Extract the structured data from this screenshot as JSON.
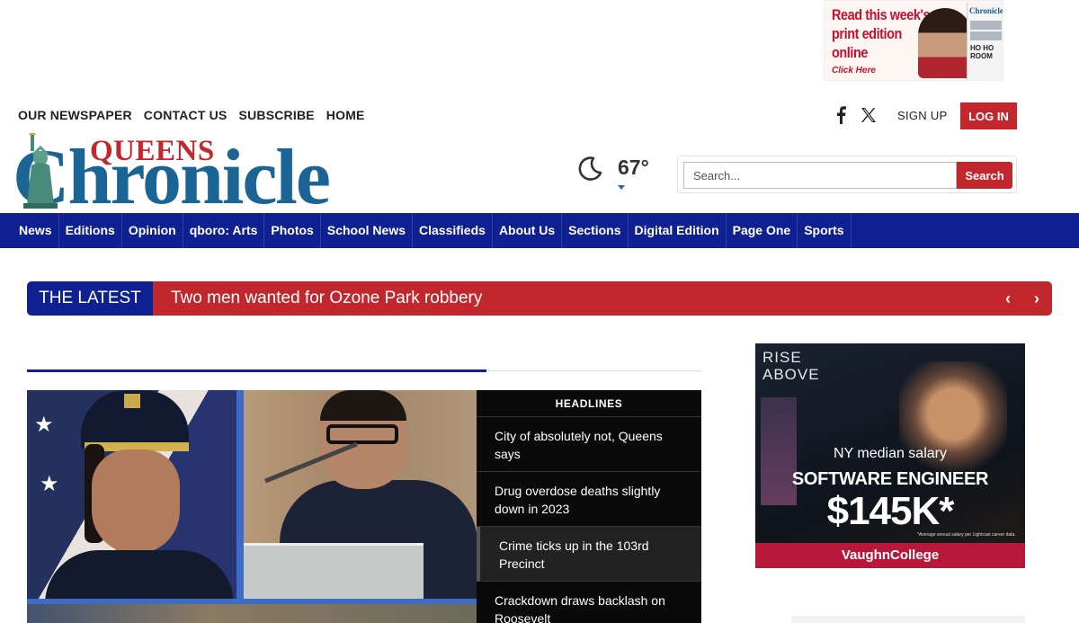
{
  "top_ad": {
    "line1": "Read this week's",
    "line2": "print edition",
    "line3": "online",
    "cta": "Click Here",
    "paper_masthead": "Chronicle",
    "paper_headline": "HO HO ROOM"
  },
  "util_nav": [
    "OUR NEWSPAPER",
    "CONTACT US",
    "SUBSCRIBE",
    "HOME"
  ],
  "account": {
    "signup": "SIGN UP",
    "login": "LOG IN"
  },
  "logo": {
    "top": "QUEENS",
    "main": "Chronicle"
  },
  "weather": {
    "temperature": "67°",
    "icon": "moon-icon"
  },
  "search": {
    "placeholder": "Search...",
    "button": "Search"
  },
  "main_nav": [
    "News",
    "Editions",
    "Opinion",
    "qboro: Arts",
    "Photos",
    "School News",
    "Classifieds",
    "About Us",
    "Sections",
    "Digital Edition",
    "Page One",
    "Sports"
  ],
  "latest": {
    "tag": "THE LATEST",
    "headline": "Two men wanted for Ozone Park robbery"
  },
  "headlines": {
    "title": "HEADLINES",
    "items": [
      "City of absolutely not, Queens says",
      "Drug overdose deaths slightly down in 2023",
      "Crime ticks up in the 103rd Precinct",
      "Crackdown draws backlash on Roosevelt"
    ]
  },
  "side_ad": {
    "rise": "RISE",
    "above": "ABOVE",
    "ny": "NY median salary",
    "role": "SOFTWARE ENGINEER",
    "salary": "$145K*",
    "fine": "*Average annual salary per Lightcast career data.",
    "brand": "VaughnCollege"
  },
  "colors": {
    "brand_blue": "#0f2090",
    "brand_red": "#c1272d",
    "logo_blue": "#1a6596"
  }
}
